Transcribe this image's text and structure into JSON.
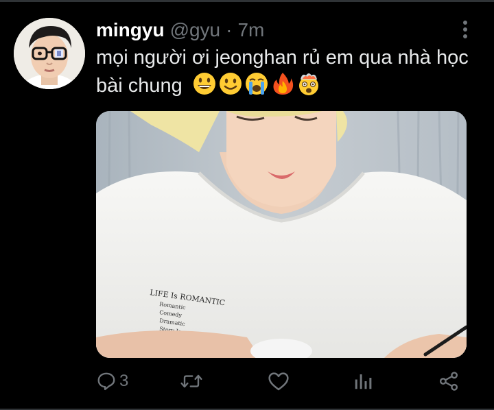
{
  "tweet": {
    "author": {
      "display_name": "mingyu",
      "handle": "@gyu",
      "separator": "·",
      "time": "7m"
    },
    "text": "mọi người ơi jeonghan rủ em qua nhà học bài chung",
    "emojis": [
      "grinning-face",
      "slightly-smiling-face",
      "loudly-crying-face",
      "fire",
      "exploding-head"
    ],
    "media": {
      "shirt_print_lines": [
        "LIFE Is ROMANTIC",
        "Romantic",
        "Comedy",
        "Dramatic",
        "Story Is"
      ]
    },
    "actions": {
      "reply_count": "3",
      "reply_icon": "reply-icon",
      "retweet_icon": "retweet-icon",
      "like_icon": "heart-icon",
      "analytics_icon": "analytics-icon",
      "share_icon": "share-icon"
    }
  },
  "colors": {
    "background": "#000000",
    "primary_text": "#e7e9ea",
    "secondary_text": "#71767b",
    "divider": "#2f3336"
  }
}
